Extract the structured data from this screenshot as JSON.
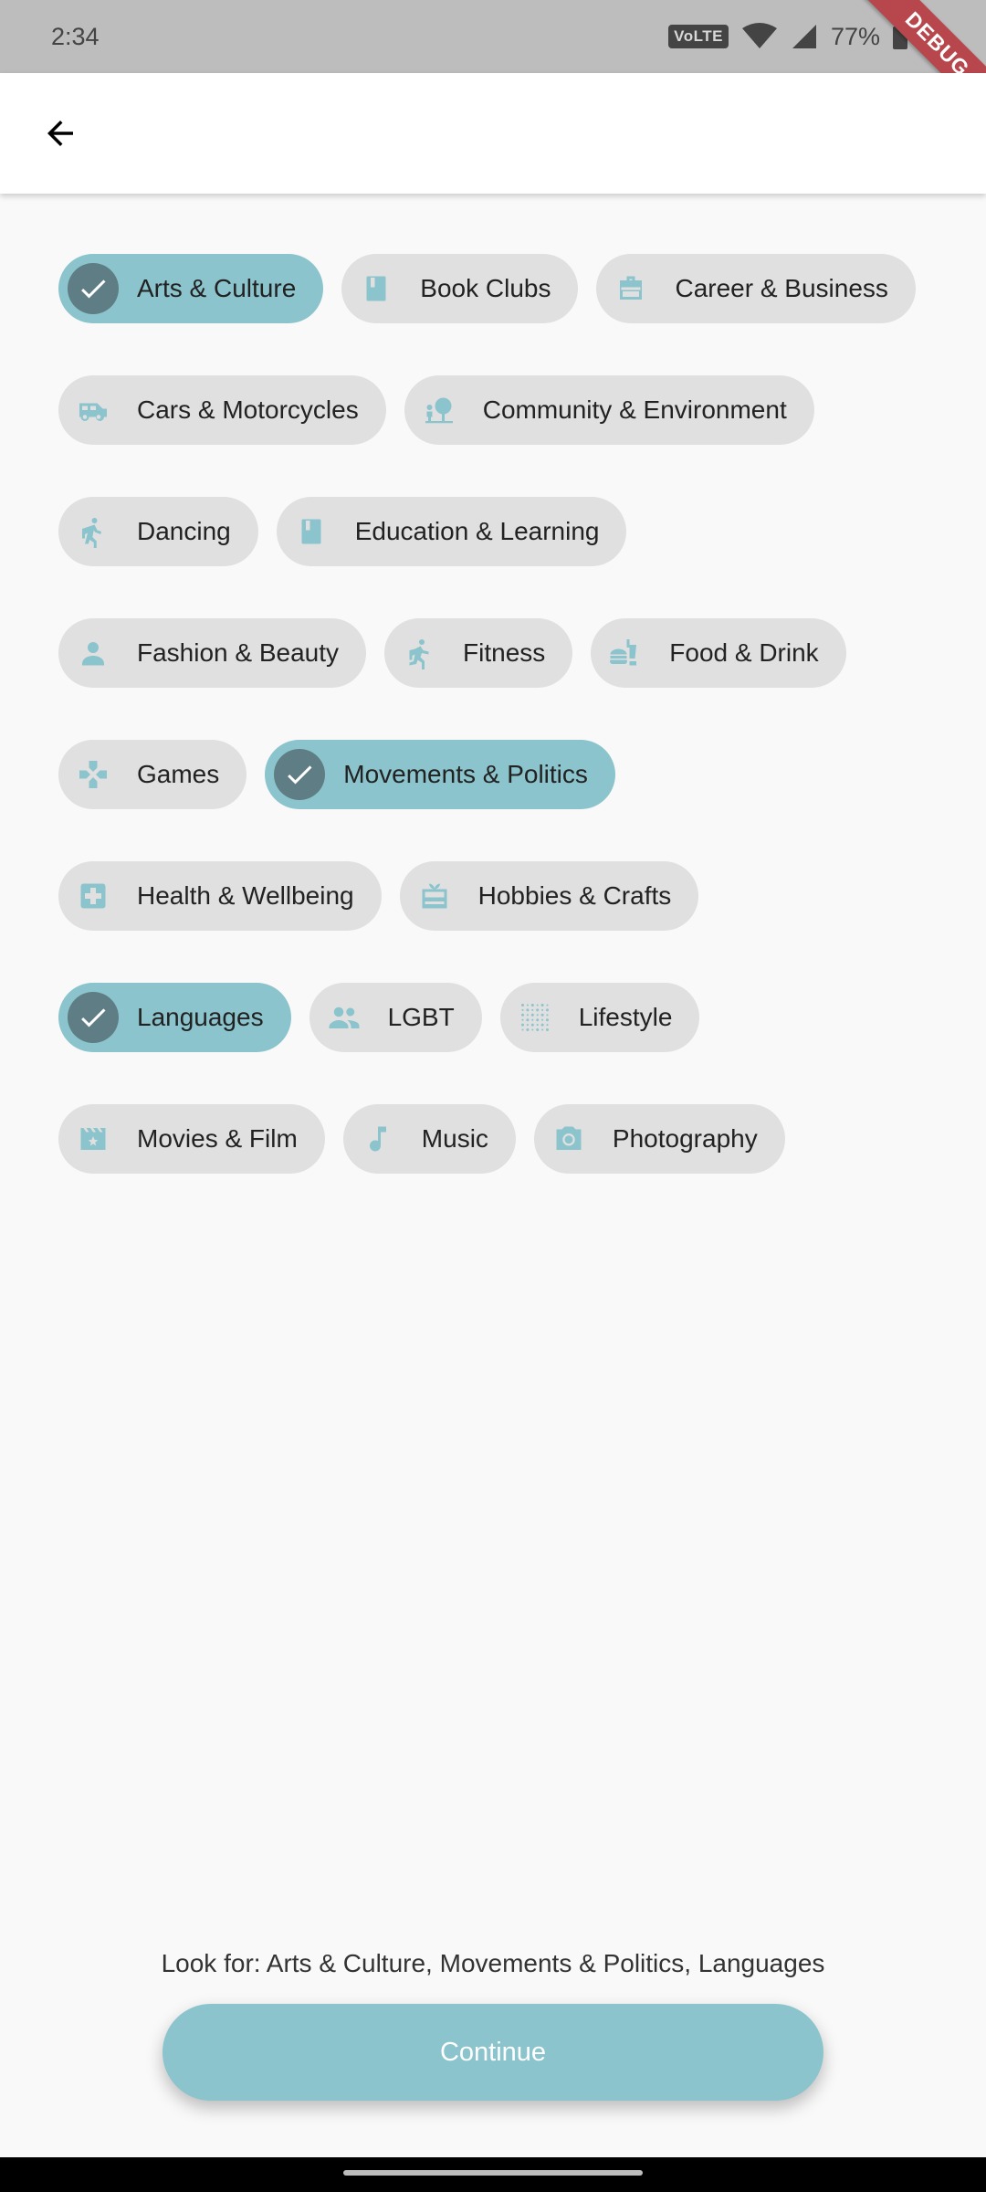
{
  "status_bar": {
    "time": "2:34",
    "network_badge": "VoLTE",
    "battery": "77%",
    "debug_label": "DEBUG"
  },
  "colors": {
    "accent": "#8bc4cc",
    "check_circle": "#5e7d84",
    "chip_bg": "#e0e0e0",
    "icon": "#8bc4cc"
  },
  "categories": [
    {
      "label": "Arts & Culture",
      "icon": "check-icon",
      "selected": true
    },
    {
      "label": "Book Clubs",
      "icon": "book-icon",
      "selected": false
    },
    {
      "label": "Career & Business",
      "icon": "briefcase-icon",
      "selected": false
    },
    {
      "label": "Cars & Motorcycles",
      "icon": "van-icon",
      "selected": false
    },
    {
      "label": "Community & Environment",
      "icon": "nature-people-icon",
      "selected": false
    },
    {
      "label": "Dancing",
      "icon": "walking-person-icon",
      "selected": false
    },
    {
      "label": "Education & Learning",
      "icon": "book-icon",
      "selected": false
    },
    {
      "label": "Fashion & Beauty",
      "icon": "person-icon",
      "selected": false
    },
    {
      "label": "Fitness",
      "icon": "running-person-icon",
      "selected": false
    },
    {
      "label": "Food & Drink",
      "icon": "fastfood-icon",
      "selected": false
    },
    {
      "label": "Games",
      "icon": "gamepad-icon",
      "selected": false
    },
    {
      "label": "Movements & Politics",
      "icon": "check-icon",
      "selected": true
    },
    {
      "label": "Health & Wellbeing",
      "icon": "medical-cross-icon",
      "selected": false
    },
    {
      "label": "Hobbies & Crafts",
      "icon": "gift-card-icon",
      "selected": false
    },
    {
      "label": "Languages",
      "icon": "check-icon",
      "selected": true
    },
    {
      "label": "LGBT",
      "icon": "people-icon",
      "selected": false
    },
    {
      "label": "Lifestyle",
      "icon": "dots-grid-icon",
      "selected": false
    },
    {
      "label": "Movies & Film",
      "icon": "movie-icon",
      "selected": false
    },
    {
      "label": "Music",
      "icon": "music-note-icon",
      "selected": false
    },
    {
      "label": "Photography",
      "icon": "camera-icon",
      "selected": false
    }
  ],
  "summary": {
    "text": "Look for: Arts & Culture, Movements & Politics, Languages"
  },
  "continue_label": "Continue"
}
